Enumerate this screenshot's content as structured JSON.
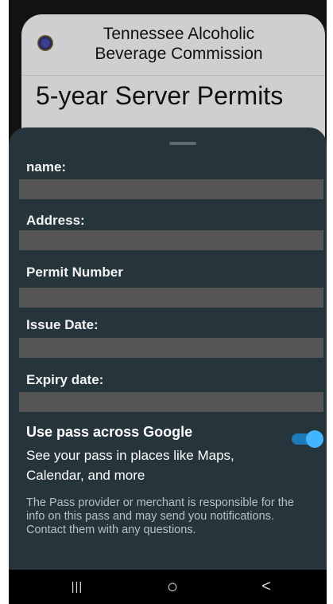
{
  "pass": {
    "issuer_name": "Tennessee Alcoholic Beverage Commission",
    "title": "5-year Server Permits"
  },
  "details": {
    "fields": [
      {
        "label": "name:",
        "value": ""
      },
      {
        "label": "Address:",
        "value": ""
      },
      {
        "label": "Permit Number",
        "value": ""
      },
      {
        "label": "Issue Date:",
        "value": ""
      },
      {
        "label": "Expiry date:",
        "value": ""
      }
    ],
    "toggle": {
      "title": "Use pass across Google",
      "subtitle": "See your pass in places like Maps, Calendar, and more",
      "enabled": true,
      "color": "#43b4ff"
    },
    "disclaimer": "The Pass provider or merchant is responsible for the info on this pass and may send you notifications. Contact them with any questions."
  },
  "navbar": {
    "recents_glyph": "|||",
    "home_glyph": "○",
    "back_glyph": "<"
  },
  "colors": {
    "sheet_bg": "#26343b",
    "field_bg": "#555555",
    "card_bg": "#cfcfcf",
    "accent": "#43b4ff"
  }
}
